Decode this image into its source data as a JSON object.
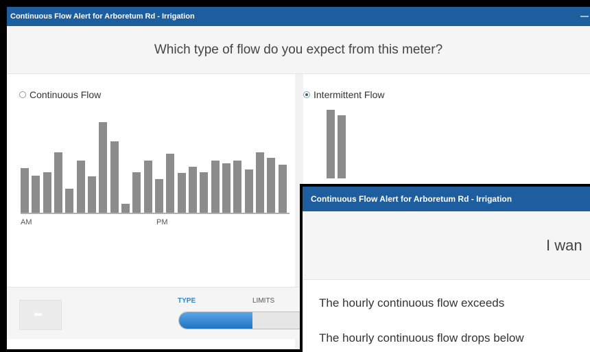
{
  "dialog_back": {
    "title": "Continuous Flow Alert for Arboretum Rd - Irrigation",
    "minimize_glyph": "—",
    "question": "Which type of flow do you expect from this meter?",
    "options": [
      {
        "label": "Continuous Flow",
        "selected": false
      },
      {
        "label": "Intermittent Flow",
        "selected": true
      }
    ],
    "axis": {
      "am": "AM",
      "pm": "PM"
    },
    "continuous_chart": {
      "type": "bar",
      "values": [
        48,
        40,
        44,
        65,
        26,
        56,
        39,
        98,
        77,
        10,
        44,
        56,
        36,
        64,
        43,
        50,
        44,
        56,
        53,
        56,
        47,
        65,
        59,
        52
      ]
    },
    "intermittent_chart": {
      "type": "bar",
      "values": [
        100,
        92
      ]
    },
    "footer": {
      "back_glyph": "⬅",
      "steps": [
        "TYPE",
        "LIMITS"
      ],
      "progress": 0.57
    }
  },
  "dialog_front": {
    "title": "Continuous Flow Alert for Arboretum Rd - Irrigation",
    "heading_partial": "I wan",
    "conditions": [
      "The hourly continuous flow exceeds",
      "The hourly continuous flow drops below"
    ]
  },
  "colors": {
    "titlebar": "#1f5e9e",
    "bar": "#8c8c8c",
    "accent": "#2f86c9"
  }
}
